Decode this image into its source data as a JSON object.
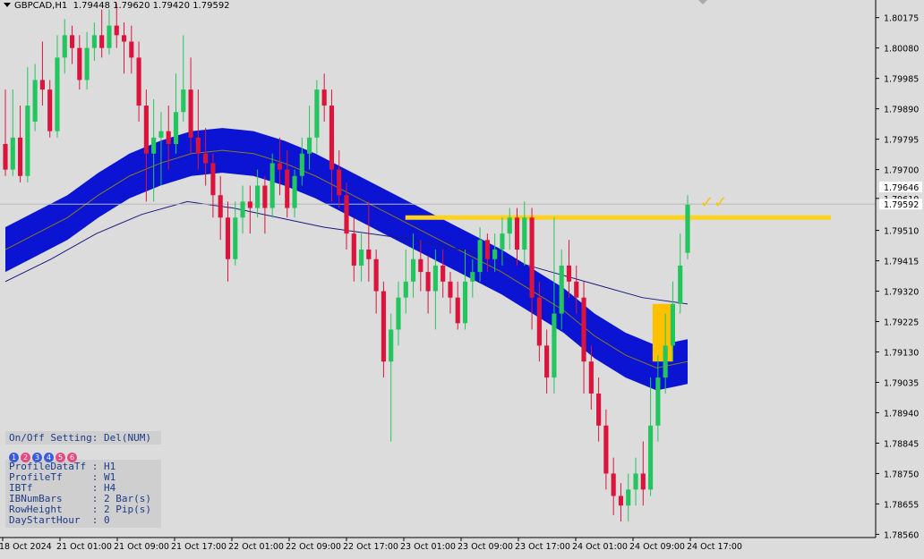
{
  "header": {
    "symbol": "GBPCAD,H1",
    "ohlc": "1.79448 1.79620 1.79420 1.79592"
  },
  "price_axis": {
    "labels": [
      "1.80175",
      "1.80080",
      "1.79985",
      "1.79890",
      "1.79795",
      "1.79700",
      "1.79610",
      "1.79510",
      "1.79415",
      "1.79320",
      "1.79225",
      "1.79130",
      "1.79035",
      "1.78940",
      "1.78845",
      "1.78750",
      "1.78655",
      "1.78560"
    ],
    "current_price": "1.79592",
    "marker_price": "1.79646"
  },
  "time_axis": {
    "labels": [
      "18 Oct 2024",
      "21 Oct 01:00",
      "21 Oct 09:00",
      "21 Oct 17:00",
      "22 Oct 01:00",
      "22 Oct 09:00",
      "22 Oct 17:00",
      "23 Oct 01:00",
      "23 Oct 09:00",
      "23 Oct 17:00",
      "24 Oct 01:00",
      "24 Oct 09:00",
      "24 Oct 17:00"
    ]
  },
  "panel": {
    "header": "On/Off Setting: Del(NUM)",
    "buttons": [
      "1",
      "2",
      "3",
      "4",
      "5",
      "6"
    ],
    "button_colors": [
      "#3b5bdb",
      "#e64980",
      "#3b5bdb",
      "#3b5bdb",
      "#e64980",
      "#e64980"
    ],
    "rows": [
      "ProfileDataTf : H1",
      "ProfileTf     : W1",
      "IBTf          : H4",
      "IBNumBars     : 2 Bar(s)",
      "RowHeight     : 2 Pip(s)",
      "DayStartHour  : 0"
    ]
  },
  "colors": {
    "background": "#dcdcdc",
    "bull": "#22c55e",
    "bear": "#dc143c",
    "band": "#0a14d2",
    "level_line": "#ffd21e",
    "signal": "#ffc000"
  },
  "annotations": {
    "checkmarks": "✓✓"
  },
  "chart_data": {
    "type": "candlestick",
    "symbol": "GBPCAD",
    "timeframe": "H1",
    "ylim": [
      1.7855,
      1.8023
    ],
    "horizontal_level": 1.7955,
    "candles": [
      {
        "o": 1.7978,
        "c": 1.797,
        "h": 1.7995,
        "l": 1.7968
      },
      {
        "o": 1.797,
        "c": 1.798,
        "h": 1.7995,
        "l": 1.7968
      },
      {
        "o": 1.798,
        "c": 1.7968,
        "h": 1.799,
        "l": 1.7966
      },
      {
        "o": 1.7968,
        "c": 1.799,
        "h": 1.8002,
        "l": 1.7966
      },
      {
        "o": 1.7985,
        "c": 1.7998,
        "h": 1.8003,
        "l": 1.7982
      },
      {
        "o": 1.7998,
        "c": 1.7995,
        "h": 1.801,
        "l": 1.799
      },
      {
        "o": 1.7995,
        "c": 1.7982,
        "h": 1.7998,
        "l": 1.798
      },
      {
        "o": 1.7982,
        "c": 1.8005,
        "h": 1.8012,
        "l": 1.798
      },
      {
        "o": 1.8005,
        "c": 1.8012,
        "h": 1.8017,
        "l": 1.8
      },
      {
        "o": 1.8012,
        "c": 1.8008,
        "h": 1.8015,
        "l": 1.8003
      },
      {
        "o": 1.8008,
        "c": 1.7998,
        "h": 1.8012,
        "l": 1.7995
      },
      {
        "o": 1.7998,
        "c": 1.8008,
        "h": 1.8013,
        "l": 1.7995
      },
      {
        "o": 1.8008,
        "c": 1.8012,
        "h": 1.8016,
        "l": 1.8004
      },
      {
        "o": 1.8012,
        "c": 1.8008,
        "h": 1.802,
        "l": 1.8005
      },
      {
        "o": 1.8008,
        "c": 1.8015,
        "h": 1.802,
        "l": 1.8006
      },
      {
        "o": 1.8015,
        "c": 1.8012,
        "h": 1.8022,
        "l": 1.8008
      },
      {
        "o": 1.8012,
        "c": 1.801,
        "h": 1.8016,
        "l": 1.8
      },
      {
        "o": 1.801,
        "c": 1.8005,
        "h": 1.8015,
        "l": 1.8
      },
      {
        "o": 1.8005,
        "c": 1.799,
        "h": 1.801,
        "l": 1.7985
      },
      {
        "o": 1.799,
        "c": 1.7975,
        "h": 1.7995,
        "l": 1.796
      },
      {
        "o": 1.7975,
        "c": 1.798,
        "h": 1.7992,
        "l": 1.796
      },
      {
        "o": 1.798,
        "c": 1.7982,
        "h": 1.7988,
        "l": 1.7965
      },
      {
        "o": 1.7982,
        "c": 1.7978,
        "h": 1.799,
        "l": 1.797
      },
      {
        "o": 1.7978,
        "c": 1.7988,
        "h": 1.8,
        "l": 1.7975
      },
      {
        "o": 1.7988,
        "c": 1.7995,
        "h": 1.8012,
        "l": 1.7985
      },
      {
        "o": 1.7995,
        "c": 1.798,
        "h": 1.8005,
        "l": 1.7975
      },
      {
        "o": 1.798,
        "c": 1.7975,
        "h": 1.7995,
        "l": 1.797
      },
      {
        "o": 1.7975,
        "c": 1.7972,
        "h": 1.7983,
        "l": 1.7965
      },
      {
        "o": 1.7972,
        "c": 1.7962,
        "h": 1.7975,
        "l": 1.7955
      },
      {
        "o": 1.7962,
        "c": 1.7955,
        "h": 1.7968,
        "l": 1.7948
      },
      {
        "o": 1.7955,
        "c": 1.7942,
        "h": 1.796,
        "l": 1.7935
      },
      {
        "o": 1.7942,
        "c": 1.7955,
        "h": 1.796,
        "l": 1.794
      },
      {
        "o": 1.7955,
        "c": 1.796,
        "h": 1.7965,
        "l": 1.795
      },
      {
        "o": 1.796,
        "c": 1.7958,
        "h": 1.7965,
        "l": 1.795
      },
      {
        "o": 1.7958,
        "c": 1.7965,
        "h": 1.797,
        "l": 1.7955
      },
      {
        "o": 1.7965,
        "c": 1.7958,
        "h": 1.7968,
        "l": 1.795
      },
      {
        "o": 1.7958,
        "c": 1.7972,
        "h": 1.7975,
        "l": 1.7955
      },
      {
        "o": 1.7972,
        "c": 1.797,
        "h": 1.798,
        "l": 1.7962
      },
      {
        "o": 1.797,
        "c": 1.7958,
        "h": 1.7976,
        "l": 1.7955
      },
      {
        "o": 1.7958,
        "c": 1.7968,
        "h": 1.797,
        "l": 1.7955
      },
      {
        "o": 1.7968,
        "c": 1.7975,
        "h": 1.798,
        "l": 1.7965
      },
      {
        "o": 1.7975,
        "c": 1.798,
        "h": 1.799,
        "l": 1.797
      },
      {
        "o": 1.798,
        "c": 1.7995,
        "h": 1.7998,
        "l": 1.7975
      },
      {
        "o": 1.7995,
        "c": 1.799,
        "h": 1.8,
        "l": 1.7985
      },
      {
        "o": 1.799,
        "c": 1.797,
        "h": 1.7995,
        "l": 1.796
      },
      {
        "o": 1.797,
        "c": 1.7962,
        "h": 1.7976,
        "l": 1.7958
      },
      {
        "o": 1.7962,
        "c": 1.795,
        "h": 1.7966,
        "l": 1.7945
      },
      {
        "o": 1.795,
        "c": 1.794,
        "h": 1.7955,
        "l": 1.7935
      },
      {
        "o": 1.794,
        "c": 1.7945,
        "h": 1.795,
        "l": 1.7935
      },
      {
        "o": 1.7945,
        "c": 1.7942,
        "h": 1.796,
        "l": 1.7935
      },
      {
        "o": 1.7942,
        "c": 1.7932,
        "h": 1.7945,
        "l": 1.7925
      },
      {
        "o": 1.7932,
        "c": 1.791,
        "h": 1.7935,
        "l": 1.7905
      },
      {
        "o": 1.791,
        "c": 1.792,
        "h": 1.7925,
        "l": 1.7885
      },
      {
        "o": 1.792,
        "c": 1.793,
        "h": 1.7935,
        "l": 1.7915
      },
      {
        "o": 1.793,
        "c": 1.7935,
        "h": 1.7945,
        "l": 1.7925
      },
      {
        "o": 1.7935,
        "c": 1.7942,
        "h": 1.795,
        "l": 1.793
      },
      {
        "o": 1.7942,
        "c": 1.7938,
        "h": 1.7948,
        "l": 1.7932
      },
      {
        "o": 1.7938,
        "c": 1.7932,
        "h": 1.7943,
        "l": 1.7925
      },
      {
        "o": 1.7932,
        "c": 1.794,
        "h": 1.7945,
        "l": 1.792
      },
      {
        "o": 1.794,
        "c": 1.7935,
        "h": 1.7945,
        "l": 1.793
      },
      {
        "o": 1.7935,
        "c": 1.793,
        "h": 1.7938,
        "l": 1.7925
      },
      {
        "o": 1.793,
        "c": 1.7922,
        "h": 1.7935,
        "l": 1.792
      },
      {
        "o": 1.7922,
        "c": 1.7935,
        "h": 1.7945,
        "l": 1.792
      },
      {
        "o": 1.7935,
        "c": 1.7938,
        "h": 1.7942,
        "l": 1.793
      },
      {
        "o": 1.7938,
        "c": 1.7948,
        "h": 1.7952,
        "l": 1.7935
      },
      {
        "o": 1.7948,
        "c": 1.7942,
        "h": 1.795,
        "l": 1.7938
      },
      {
        "o": 1.7942,
        "c": 1.7945,
        "h": 1.795,
        "l": 1.7938
      },
      {
        "o": 1.7945,
        "c": 1.795,
        "h": 1.7955,
        "l": 1.794
      },
      {
        "o": 1.795,
        "c": 1.7955,
        "h": 1.7958,
        "l": 1.7945
      },
      {
        "o": 1.7955,
        "c": 1.7945,
        "h": 1.7958,
        "l": 1.794
      },
      {
        "o": 1.7945,
        "c": 1.7955,
        "h": 1.796,
        "l": 1.794
      },
      {
        "o": 1.7955,
        "c": 1.793,
        "h": 1.7958,
        "l": 1.792
      },
      {
        "o": 1.793,
        "c": 1.7915,
        "h": 1.7935,
        "l": 1.791
      },
      {
        "o": 1.7915,
        "c": 1.7905,
        "h": 1.792,
        "l": 1.79
      },
      {
        "o": 1.7905,
        "c": 1.7925,
        "h": 1.7955,
        "l": 1.79
      },
      {
        "o": 1.7925,
        "c": 1.794,
        "h": 1.7945,
        "l": 1.792
      },
      {
        "o": 1.794,
        "c": 1.7935,
        "h": 1.7948,
        "l": 1.793
      },
      {
        "o": 1.7935,
        "c": 1.793,
        "h": 1.794,
        "l": 1.7925
      },
      {
        "o": 1.793,
        "c": 1.791,
        "h": 1.7935,
        "l": 1.79
      },
      {
        "o": 1.791,
        "c": 1.79,
        "h": 1.7915,
        "l": 1.7895
      },
      {
        "o": 1.79,
        "c": 1.789,
        "h": 1.7905,
        "l": 1.7885
      },
      {
        "o": 1.789,
        "c": 1.7875,
        "h": 1.7895,
        "l": 1.787
      },
      {
        "o": 1.7875,
        "c": 1.7868,
        "h": 1.788,
        "l": 1.7862
      },
      {
        "o": 1.7868,
        "c": 1.7865,
        "h": 1.7872,
        "l": 1.786
      },
      {
        "o": 1.7865,
        "c": 1.787,
        "h": 1.7875,
        "l": 1.786
      },
      {
        "o": 1.787,
        "c": 1.7875,
        "h": 1.788,
        "l": 1.7865
      },
      {
        "o": 1.7875,
        "c": 1.787,
        "h": 1.7885,
        "l": 1.7865
      },
      {
        "o": 1.787,
        "c": 1.789,
        "h": 1.7905,
        "l": 1.7868
      },
      {
        "o": 1.789,
        "c": 1.7905,
        "h": 1.7912,
        "l": 1.7885
      },
      {
        "o": 1.7905,
        "c": 1.7915,
        "h": 1.7925,
        "l": 1.79
      },
      {
        "o": 1.7915,
        "c": 1.7928,
        "h": 1.7935,
        "l": 1.791
      },
      {
        "o": 1.7928,
        "c": 1.794,
        "h": 1.795,
        "l": 1.7925
      },
      {
        "o": 1.7944,
        "c": 1.7959,
        "h": 1.7962,
        "l": 1.7942
      }
    ],
    "band_center": [
      1.7945,
      1.795,
      1.7955,
      1.7962,
      1.7968,
      1.7972,
      1.7975,
      1.7976,
      1.7975,
      1.7972,
      1.7968,
      1.7963,
      1.7958,
      1.7953,
      1.7948,
      1.7943,
      1.7938,
      1.7932,
      1.7926,
      1.7918,
      1.7912,
      1.7908,
      1.791
    ],
    "band_halfwidth": 0.0007,
    "slow_ma": [
      1.7935,
      1.7942,
      1.795,
      1.7956,
      1.796,
      1.7958,
      1.7955,
      1.7952,
      1.795,
      1.7948,
      1.7945,
      1.7942,
      1.7938,
      1.7934,
      1.793,
      1.7928
    ]
  }
}
